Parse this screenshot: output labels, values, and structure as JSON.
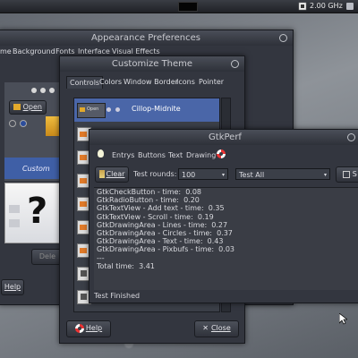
{
  "panel": {
    "cpu_freq": "2.00 GHz"
  },
  "appearance": {
    "title": "Appearance Preferences",
    "menu": [
      "me",
      "Background",
      "Fonts",
      "Interface",
      "Visual Effects"
    ],
    "open_label": "Open",
    "custom_label": "Custom",
    "question": "?",
    "delete_label": "Dele",
    "help_label": "Help"
  },
  "customize": {
    "title": "Customize Theme",
    "tabs": [
      "Controls",
      "Colors",
      "Window Border",
      "Icons",
      "Pointer"
    ],
    "selected_theme": "Cillop-Midnite",
    "help_label": "Help",
    "close_label": "Close"
  },
  "gtkperf": {
    "title": "GtkPerf",
    "toolbar": [
      "Entrys",
      "Buttons",
      "Text",
      "Drawing"
    ],
    "clear_label": "Clear",
    "rounds_label": "Test rounds:",
    "rounds_value": "100",
    "test_select": "Test All",
    "start_partial": "S",
    "log": [
      "GtkCheckButton - time:  0.08",
      "GtkRadioButton - time:  0.20",
      "GtkTextView - Add text - time:  0.35",
      "GtkTextView - Scroll - time:  0.19",
      "GtkDrawingArea - Lines - time:  0.27",
      "GtkDrawingArea - Circles - time:  0.37",
      "GtkDrawingArea - Text - time:  0.43",
      "GtkDrawingArea - Pixbufs - time:  0.03",
      "---",
      "Total time:  3.41"
    ],
    "status": "Test Finished"
  }
}
